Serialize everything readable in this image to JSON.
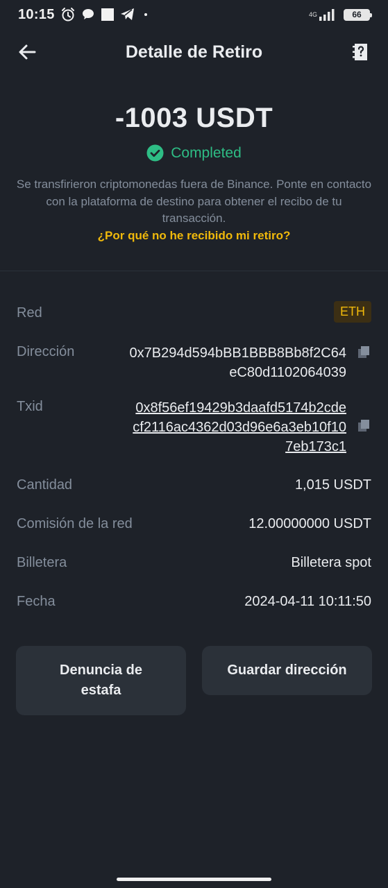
{
  "status_bar": {
    "time": "10:15",
    "network": "4G",
    "battery": "66"
  },
  "header": {
    "title": "Detalle de Retiro"
  },
  "summary": {
    "amount": "-1003 USDT",
    "status": "Completed",
    "status_color": "#2ebd85",
    "info": "Se transfirieron criptomonedas fuera de Binance. Ponte en contacto con la plataforma de destino para obtener el recibo de tu transacción.",
    "help_link": "¿Por qué no he recibido mi retiro?"
  },
  "details": {
    "network_label": "Red",
    "network_value": "ETH",
    "address_label": "Dirección",
    "address_value": "0x7B294d594bBB1BBB8Bb8f2C64eC80d1102064039",
    "txid_label": "Txid",
    "txid_value": "0x8f56ef19429b3daafd5174b2cdecf2116ac4362d03d96e6a3eb10f107eb173c1",
    "amount_label": "Cantidad",
    "amount_value": "1,015 USDT",
    "fee_label": "Comisión de la red",
    "fee_value": "12.00000000 USDT",
    "wallet_label": "Billetera",
    "wallet_value": "Billetera spot",
    "date_label": "Fecha",
    "date_value": "2024-04-11 10:11:50"
  },
  "actions": {
    "report": "Denuncia de estafa",
    "save_address": "Guardar dirección"
  },
  "colors": {
    "background": "#1e2229",
    "accent": "#f0b90b",
    "success": "#2ebd85",
    "muted": "#848e9c"
  }
}
